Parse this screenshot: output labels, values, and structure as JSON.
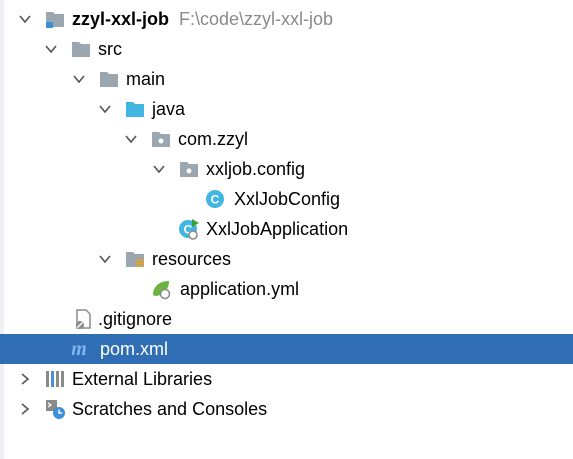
{
  "project": {
    "name": "zzyl-xxl-job",
    "path": "F:\\code\\zzyl-xxl-job"
  },
  "tree": {
    "src": "src",
    "main": "main",
    "java": "java",
    "package_com": "com.zzyl",
    "package_config": "xxljob.config",
    "class_config": "XxlJobConfig",
    "class_app": "XxlJobApplication",
    "resources": "resources",
    "yml": "application.yml",
    "gitignore": ".gitignore",
    "pom": "pom.xml",
    "external_libraries": "External Libraries",
    "scratches": "Scratches and Consoles"
  },
  "colors": {
    "selection": "#2f6db5",
    "folder": "#9aa7b0",
    "source_folder": "#40b6e0",
    "class_icon": "#40b6e0",
    "spring_leaf": "#6db33f"
  },
  "icons": {
    "pom_icon_letter": "m",
    "class_icon_letter": "C"
  }
}
